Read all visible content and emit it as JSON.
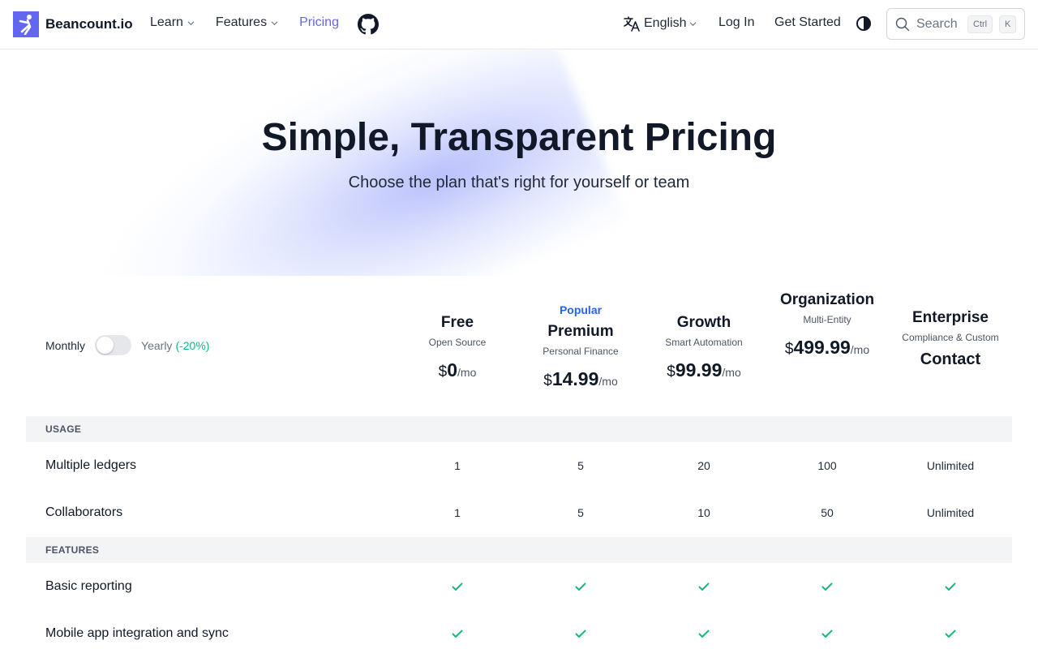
{
  "header": {
    "brand": "Beancount.io",
    "nav": [
      {
        "label": "Learn",
        "dropdown": true,
        "active": false
      },
      {
        "label": "Features",
        "dropdown": true,
        "active": false
      },
      {
        "label": "Pricing",
        "dropdown": false,
        "active": true
      }
    ],
    "language": "English",
    "login": "Log In",
    "get_started": "Get Started",
    "search": {
      "placeholder": "Search",
      "kbd_ctrl": "Ctrl",
      "kbd_k": "K"
    }
  },
  "hero": {
    "title": "Simple, Transparent Pricing",
    "subtitle": "Choose the plan that's right for yourself or team"
  },
  "billing": {
    "monthly": "Monthly",
    "yearly": "Yearly",
    "discount": "(-20%)",
    "yearly_selected": false
  },
  "plans": [
    {
      "name": "Free",
      "desc": "Open Source",
      "currency": "$",
      "amount": "0",
      "period": "/mo",
      "popular": ""
    },
    {
      "name": "Premium",
      "desc": "Personal Finance",
      "currency": "$",
      "amount": "14.99",
      "period": "/mo",
      "popular": "Popular"
    },
    {
      "name": "Growth",
      "desc": "Smart Automation",
      "currency": "$",
      "amount": "99.99",
      "period": "/mo",
      "popular": ""
    },
    {
      "name": "Organization",
      "desc": "Multi-Entity",
      "currency": "$",
      "amount": "499.99",
      "period": "/mo",
      "popular": ""
    },
    {
      "name": "Enterprise",
      "desc": "Compliance & Custom",
      "contact": "Contact",
      "popular": ""
    }
  ],
  "sections": [
    {
      "title": "USAGE",
      "rows": [
        {
          "label": "Multiple ledgers",
          "values": [
            "1",
            "5",
            "20",
            "100",
            "Unlimited"
          ]
        },
        {
          "label": "Collaborators",
          "values": [
            "1",
            "5",
            "10",
            "50",
            "Unlimited"
          ]
        }
      ]
    },
    {
      "title": "FEATURES",
      "rows": [
        {
          "label": "Basic reporting",
          "checks": [
            true,
            true,
            true,
            true,
            true
          ]
        },
        {
          "label": "Mobile app integration and sync",
          "checks": [
            true,
            true,
            true,
            true,
            true
          ]
        }
      ]
    }
  ],
  "colors": {
    "accent": "#6366f1",
    "check": "#10b981",
    "popular": "#2563eb",
    "discount": "#10b981"
  },
  "icons": {
    "logo": "brand-logo-icon",
    "chevron": "chevron-down-icon",
    "github": "github-icon",
    "translate": "translate-icon",
    "theme": "theme-toggle-icon",
    "search": "search-icon",
    "check": "check-icon"
  }
}
